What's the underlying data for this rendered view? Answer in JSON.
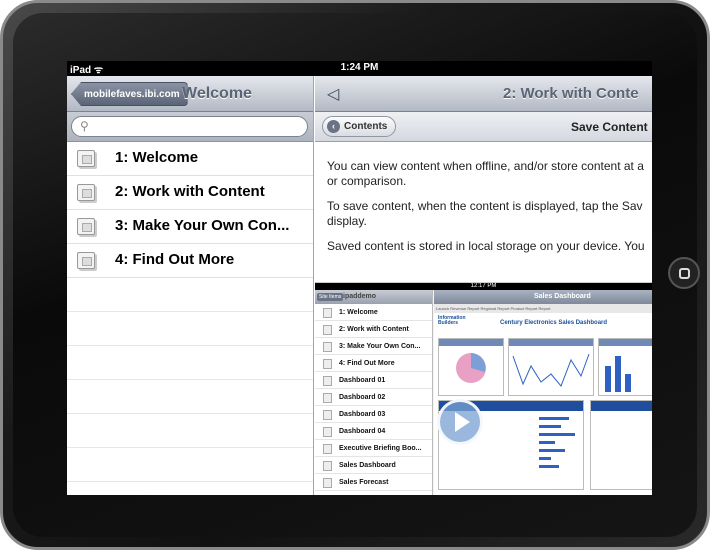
{
  "status_bar": {
    "carrier": "iPad ᯤ",
    "time": "1:24 PM"
  },
  "left_pane": {
    "back_button": "mobilefaves.ibi.com",
    "title": "Welcome",
    "search_placeholder": "",
    "items": [
      {
        "label": "1: Welcome"
      },
      {
        "label": "2: Work with Content"
      },
      {
        "label": "3: Make Your Own Con..."
      },
      {
        "label": "4: Find Out More"
      }
    ]
  },
  "right_pane": {
    "title": "2: Work with Conte",
    "contents_button": "Contents",
    "save_label": "Save Content",
    "paragraphs": [
      {
        "text": "You can view content when offline, and/or store content at a",
        "cont": "or comparison."
      },
      {
        "text": "To save content, when the content is displayed, tap the Sav",
        "cont": "display."
      },
      {
        "text": "Saved content is stored in local storage on your device. You",
        "cont": ""
      }
    ]
  },
  "embedded_screenshot": {
    "time": "12:17 PM",
    "back": "Site Items",
    "nav_title": "ipaddemo",
    "right_title": "Sales Dashboard",
    "tabs_text": "Launch  Revenue Report  Regional Report  Product Report  Report",
    "brand": "Information Builders",
    "dashboard_title": "Century Electronics Sales Dashboard",
    "items": [
      "1: Welcome",
      "2: Work with Content",
      "3: Make Your Own Con...",
      "4: Find Out More",
      "Dashboard 01",
      "Dashboard 02",
      "Dashboard 03",
      "Dashboard 04",
      "Executive Briefing Boo...",
      "Sales Dashboard",
      "Sales Forecast"
    ]
  }
}
